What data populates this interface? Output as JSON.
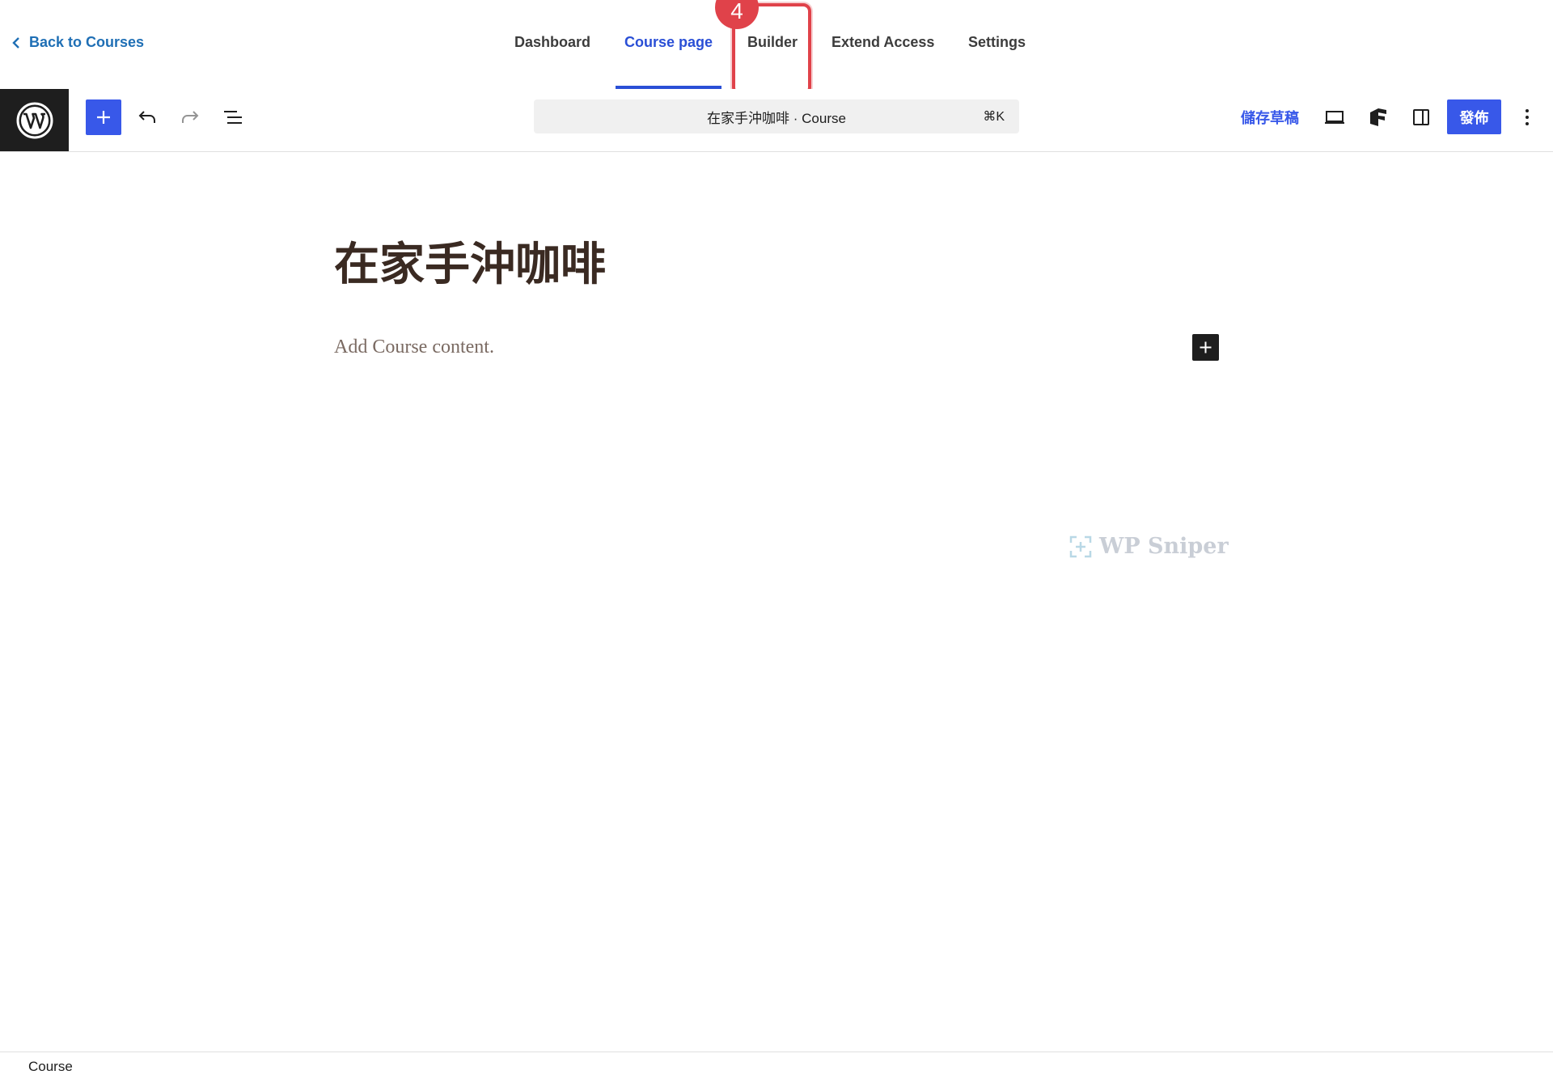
{
  "topnav": {
    "back_label": "Back to Courses",
    "tabs": [
      {
        "label": "Dashboard"
      },
      {
        "label": "Course page",
        "active": true
      },
      {
        "label": "Builder"
      },
      {
        "label": "Extend Access"
      },
      {
        "label": "Settings"
      }
    ],
    "step_badge": "4"
  },
  "toolbar": {
    "document_title": "在家手沖咖啡 · Course",
    "shortcut": "⌘K",
    "save_draft": "儲存草稿",
    "publish": "發佈"
  },
  "editor": {
    "post_title": "在家手沖咖啡",
    "content_placeholder": "Add Course content.",
    "watermark": "WP Sniper"
  },
  "footer": {
    "breadcrumb": "Course"
  },
  "colors": {
    "accent": "#3858e9",
    "highlight": "#e0424a",
    "link": "#1f6fb5"
  }
}
